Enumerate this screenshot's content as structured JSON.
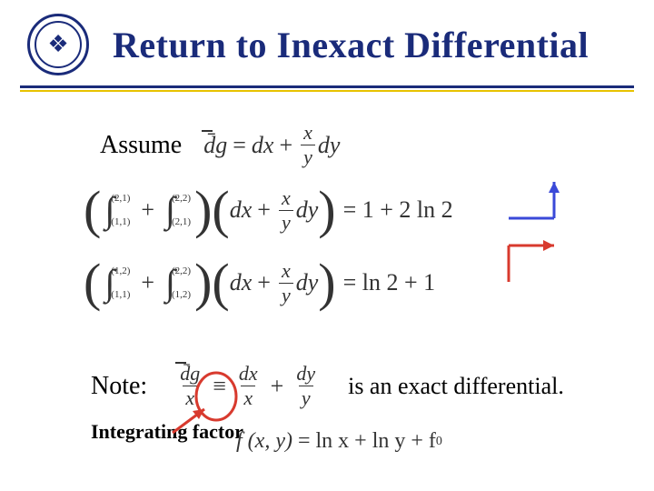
{
  "header": {
    "title": "Return to Inexact Differential",
    "logo_glyph": "❖"
  },
  "assume": {
    "label": "Assume",
    "formula": {
      "lhs": "d̄g",
      "op": "=",
      "term1": "dx",
      "plus": "+",
      "frac_num": "x",
      "frac_den": "y",
      "term2_suffix": "dy"
    }
  },
  "equations": [
    {
      "int1": {
        "low": "(1,1)",
        "up": "(2,1)"
      },
      "plus1": "+",
      "int2": {
        "low": "(2,1)",
        "up": "(2,2)"
      },
      "integrand": {
        "t1": "dx",
        "plus": "+",
        "num": "x",
        "den": "y",
        "suf": "dy"
      },
      "result": "= 1 + 2 ln 2"
    },
    {
      "int1": {
        "low": "(1,1)",
        "up": "(1,2)"
      },
      "plus1": "+",
      "int2": {
        "low": "(1,2)",
        "up": "(2,2)"
      },
      "integrand": {
        "t1": "dx",
        "plus": "+",
        "num": "x",
        "den": "y",
        "suf": "dy"
      },
      "result": "= ln 2 + 1"
    }
  ],
  "note": {
    "label": "Note:",
    "formula": {
      "lhs_num": "d̄g",
      "lhs_den": "x",
      "ident": "≡",
      "t1_num": "dx",
      "t1_den": "x",
      "plus": "+",
      "t2_num": "dy",
      "t2_den": "y"
    },
    "trailing": "is an exact differential."
  },
  "integrating_factor": "Integrating factor",
  "f_result": {
    "lhs": "f (x, y)",
    "eq": "=",
    "rhs": "ln x + ln y + f",
    "sub": "0"
  },
  "colors": {
    "accent": "#1a2b7a",
    "gold": "#e8c200",
    "red": "#d83a2e",
    "blue_arrow": "#3a49d8"
  }
}
